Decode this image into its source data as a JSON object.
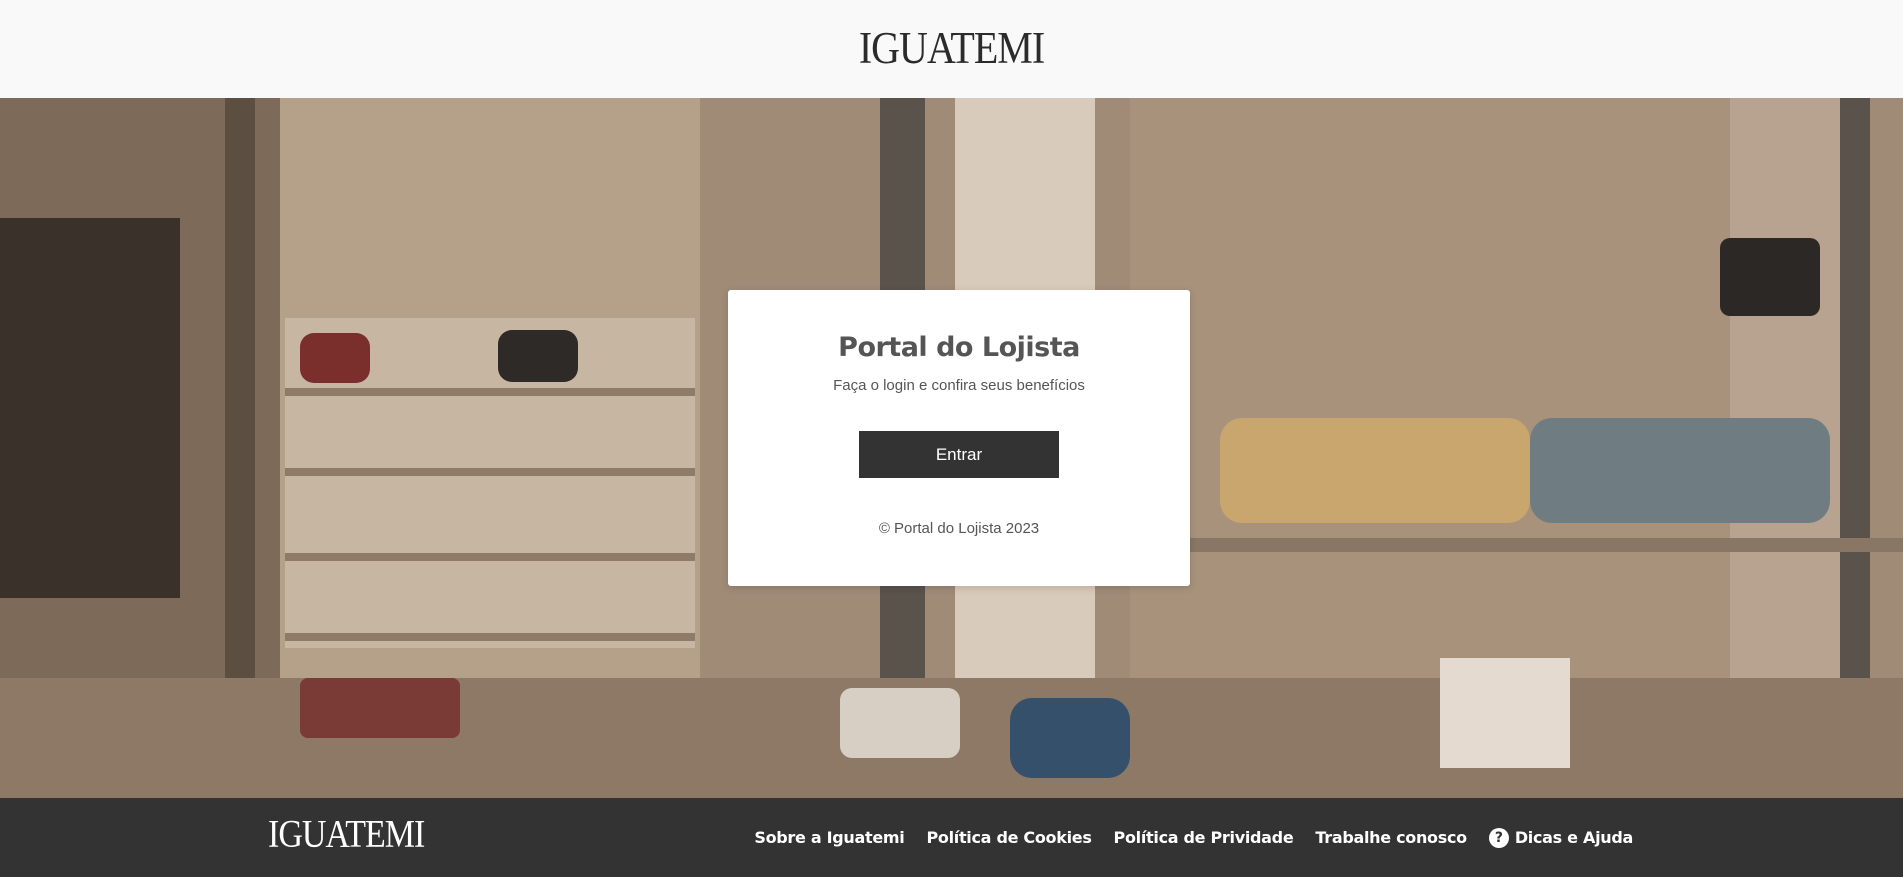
{
  "header": {
    "logo_text": "IGUATEMI"
  },
  "card": {
    "title": "Portal do Lojista",
    "subtitle": "Faça o login e confira seus benefícios",
    "enter_label": "Entrar",
    "copyright": "© Portal do Lojista 2023"
  },
  "footer": {
    "logo_text": "IGUATEMI",
    "links": [
      {
        "label": "Sobre a Iguatemi"
      },
      {
        "label": "Política de Cookies"
      },
      {
        "label": "Política de Prividade"
      },
      {
        "label": "Trabalhe conosco"
      },
      {
        "label": "Dicas e Ajuda",
        "icon": "help-circle-icon"
      }
    ]
  },
  "colors": {
    "header_bg": "#f9f9f9",
    "footer_bg": "#333333",
    "button_bg": "#333333",
    "text_gray": "#555555"
  }
}
